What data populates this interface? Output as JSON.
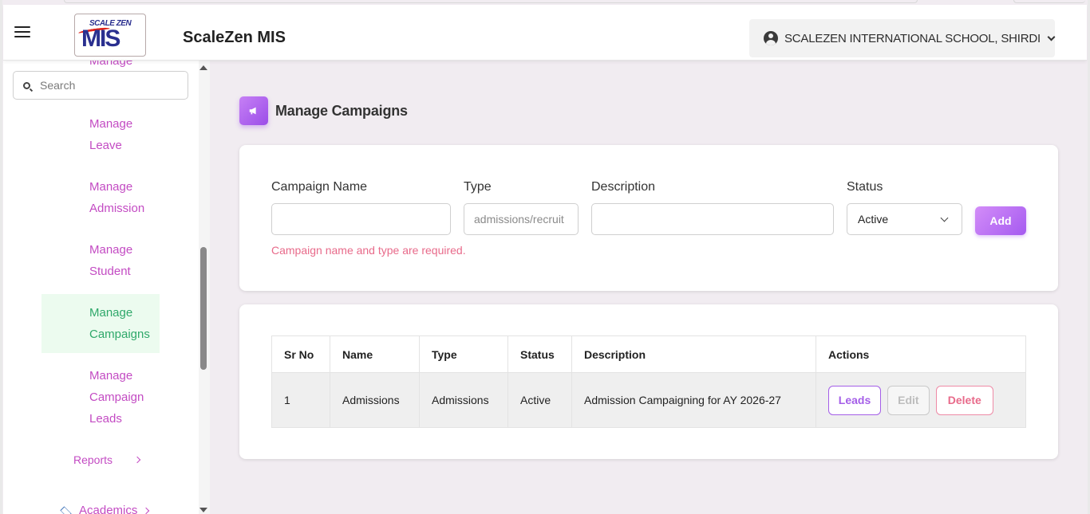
{
  "header": {
    "app_title": "ScaleZen MIS",
    "logo_top": "SCALE ZEN",
    "logo_main": "MIS",
    "school_name": "SCALEZEN INTERNATIONAL SCHOOL, SHIRDI"
  },
  "sidebar": {
    "cut_item": "Manage",
    "search_placeholder": "Search",
    "items": [
      {
        "line1": "Manage",
        "line2": "Leave"
      },
      {
        "line1": "Manage",
        "line2": "Admission"
      },
      {
        "line1": "Manage",
        "line2": "Student"
      },
      {
        "line1": "Manage",
        "line2": "Campaigns"
      },
      {
        "line1": "Manage",
        "line2": "Campaign",
        "line3": "Leads"
      }
    ],
    "reports_label": "Reports",
    "academics_label": "Academics"
  },
  "page": {
    "title": "Manage Campaigns"
  },
  "form": {
    "campaign_name_label": "Campaign Name",
    "campaign_name_value": "",
    "type_label": "Type",
    "type_placeholder": "admissions/recruit",
    "description_label": "Description",
    "description_value": "",
    "status_label": "Status",
    "status_value": "Active",
    "add_label": "Add",
    "error": "Campaign name and type are required."
  },
  "table": {
    "headers": [
      "Sr No",
      "Name",
      "Type",
      "Status",
      "Description",
      "Actions"
    ],
    "rows": [
      {
        "sr": "1",
        "name": "Admissions",
        "type": "Admissions",
        "status": "Active",
        "description": "Admission Campaigning for AY 2026-27",
        "actions": {
          "leads": "Leads",
          "edit": "Edit",
          "delete": "Delete"
        }
      }
    ]
  },
  "colors": {
    "accent": "#a55af0",
    "sidebar_link": "#c34bc3",
    "active_link": "#2fa86a",
    "error": "#e86a8a"
  }
}
